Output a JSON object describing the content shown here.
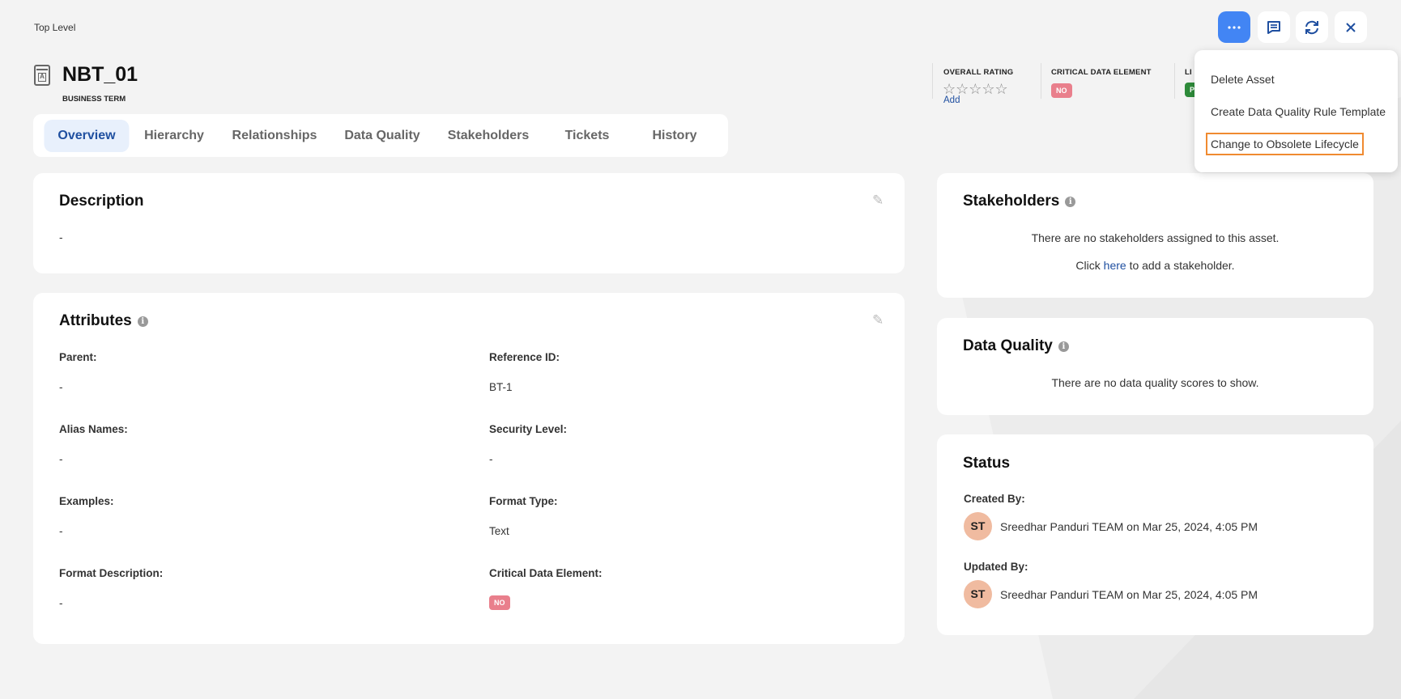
{
  "breadcrumb": "Top Level",
  "asset": {
    "icon": "business-term-icon",
    "name": "NBT_01",
    "type": "BUSINESS TERM"
  },
  "header_meta": {
    "overall_rating": {
      "label": "OVERALL RATING",
      "stars": 0,
      "max_stars": 5,
      "star_glyphs": "☆☆☆☆☆",
      "add_label": "Add"
    },
    "critical_data_element": {
      "label": "CRITICAL DATA ELEMENT",
      "value": "NO"
    },
    "lifecycle": {
      "label_visible": "LI",
      "value_visible": "P"
    }
  },
  "toolbar": {
    "more_icon": "more-horizontal-icon",
    "comment_icon": "comment-icon",
    "refresh_icon": "refresh-icon",
    "close_icon": "close-icon",
    "primary_color": "#4285f4"
  },
  "more_menu": {
    "items": [
      {
        "label": "Delete Asset"
      },
      {
        "label": "Create Data Quality Rule Template"
      },
      {
        "label": "Change to Obsolete Lifecycle",
        "highlighted": true
      }
    ],
    "highlight_color": "#f08a30"
  },
  "tabs": [
    {
      "label": "Overview",
      "active": true
    },
    {
      "label": "Hierarchy"
    },
    {
      "label": "Relationships"
    },
    {
      "label": "Data Quality"
    },
    {
      "label": "Stakeholders"
    },
    {
      "label": "Tickets"
    },
    {
      "label": "History"
    }
  ],
  "description": {
    "title": "Description",
    "value": "-"
  },
  "attributes": {
    "title": "Attributes",
    "fields": [
      {
        "label": "Parent:",
        "value": "-"
      },
      {
        "label": "Reference ID:",
        "value": "BT-1"
      },
      {
        "label": "Alias Names:",
        "value": "-"
      },
      {
        "label": "Security Level:",
        "value": "-"
      },
      {
        "label": "Examples:",
        "value": "-"
      },
      {
        "label": "Format Type:",
        "value": "Text"
      },
      {
        "label": "Format Description:",
        "value": "-"
      },
      {
        "label": "Critical Data Element:",
        "value": "NO"
      }
    ]
  },
  "stakeholders": {
    "title": "Stakeholders",
    "empty": "There are no stakeholders assigned to this asset.",
    "click": "Click",
    "here": "here",
    "suffix": "to add a stakeholder."
  },
  "data_quality": {
    "title": "Data Quality",
    "empty": "There are no data quality scores to show."
  },
  "status": {
    "title": "Status",
    "created_label": "Created By:",
    "created_initials": "ST",
    "created_text": "Sreedhar Panduri TEAM on Mar 25, 2024, 4:05 PM",
    "updated_label": "Updated By:",
    "updated_initials": "ST",
    "updated_text": "Sreedhar Panduri TEAM on Mar 25, 2024, 4:05 PM"
  }
}
